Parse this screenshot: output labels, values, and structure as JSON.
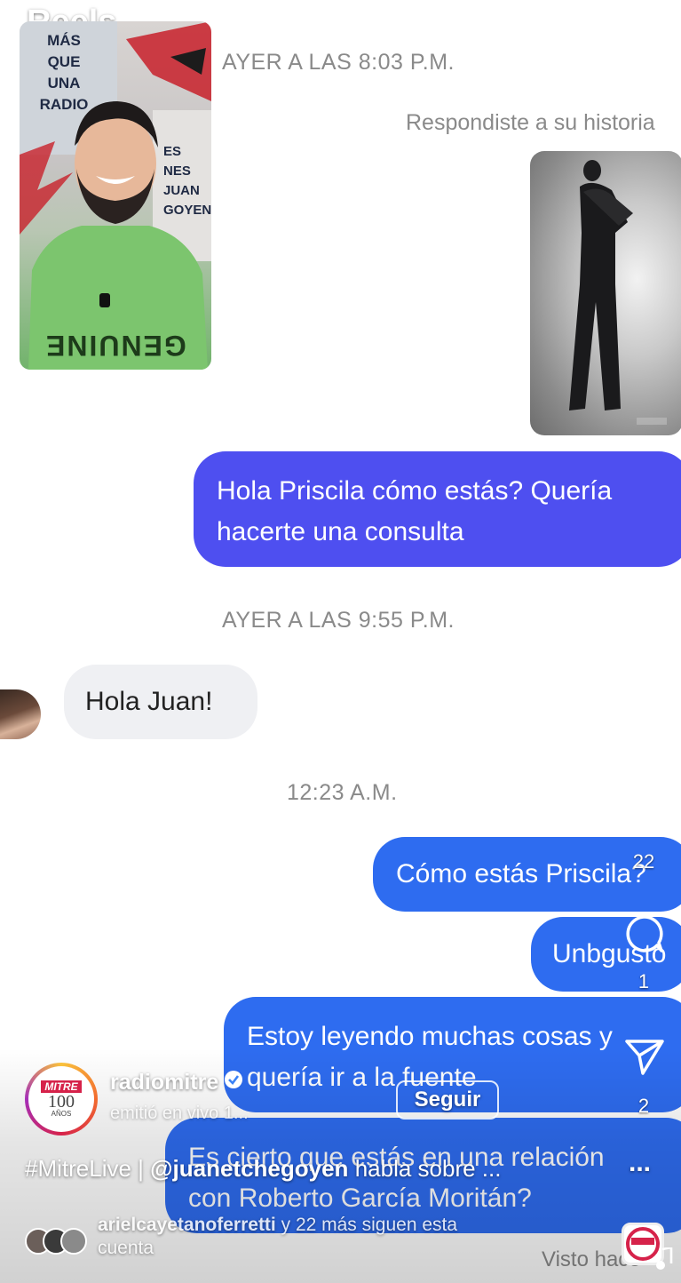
{
  "header": {
    "title": "Reels",
    "chevron_icon": "chevron-down-icon",
    "camera_icon": "camera-icon"
  },
  "video_thumbnail": {
    "poster_lines": [
      "MÁS",
      "QUE",
      "UNA",
      "RADIO"
    ],
    "poster_right_lines": [
      "ES",
      "NES",
      "JUAN",
      "GOYEN"
    ],
    "shirt_text": "GENUINE"
  },
  "chat": {
    "timestamp_1": "AYER A LAS 8:03 P.M.",
    "story_reply_label": "Respondiste a su historia",
    "message_1_line1": "Hola Priscila cómo estás? Quería",
    "message_1_line2": "hacerte una consulta",
    "timestamp_2": "AYER A LAS 9:55 P.M.",
    "reply_1": "Hola Juan!",
    "timestamp_3": "12:23 A.M.",
    "message_2": "Cómo estás Priscila?",
    "message_3": "Unbgusto",
    "message_4_line1": "Estoy leyendo muchas cosas y",
    "message_4_line2": "quería ir a la fuente",
    "message_5_line1": "Es cierto que estás en una relación",
    "message_5_line2": "con Roberto García Moritán?",
    "seen_label": "Visto hace"
  },
  "actions": {
    "like_count": "22",
    "comment_count": "1",
    "share_count": "2",
    "more_label": "..."
  },
  "account": {
    "username": "radiomitre",
    "subtitle": "emitió en vivo 1...",
    "follow_label": "Seguir",
    "logo_top": "MITRE",
    "logo_number": "100",
    "logo_bottom": "AÑOS",
    "caption_hashtag": "#MitreLive",
    "caption_mention": "@juanetchegoyen",
    "caption_rest": "habla sobre ...",
    "followers_name": "arielcayetanoferretti",
    "followers_rest": "y 22 más siguen esta",
    "followers_tail": "cuenta"
  },
  "colors": {
    "bubble_purple": "#4e4ff0",
    "bubble_blue": "#2e6cf0",
    "bubble_gray": "#eff0f3",
    "timestamp_gray": "#8a8a8a"
  }
}
